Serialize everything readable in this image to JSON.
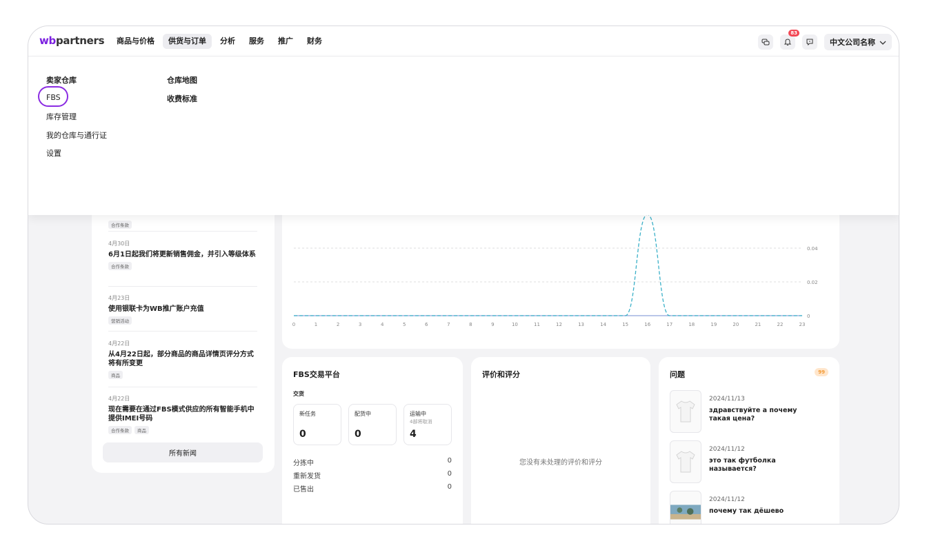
{
  "header": {
    "logo_prefix": "wb",
    "logo_suffix": "partners",
    "nav": [
      "商品与价格",
      "供货与订单",
      "分析",
      "服务",
      "推广",
      "财务"
    ],
    "notification_count": "83",
    "company_name": "中文公司名称"
  },
  "dropdown": {
    "col1": [
      "卖家仓库",
      "FBS",
      "库存管理",
      "我的仓库与通行证",
      "设置"
    ],
    "col2": [
      "仓库地图",
      "收费标准"
    ]
  },
  "news": {
    "partial_tag": "合作条款",
    "items": [
      {
        "date": "4月30日",
        "title": "6月1日起我们将更新销售佣金，并引入等级体系",
        "tags": [
          "合作条款"
        ]
      },
      {
        "date": "4月23日",
        "title": "使用银联卡为WB推广账户充值",
        "tags": [
          "营销活动"
        ]
      },
      {
        "date": "4月22日",
        "title": "从4月22日起，部分商品的商品详情页评分方式将有所变更",
        "tags": [
          "商品"
        ]
      },
      {
        "date": "4月22日",
        "title": "现在需要在通过FBS模式供应的所有智能手机中提供IMEI号码",
        "tags": [
          "合作条款",
          "商品"
        ]
      }
    ],
    "all_news": "所有新闻"
  },
  "chart_data": {
    "type": "line",
    "x": [
      0,
      1,
      2,
      3,
      4,
      5,
      6,
      7,
      8,
      9,
      10,
      11,
      12,
      13,
      14,
      15,
      16,
      17,
      18,
      19,
      20,
      21,
      22,
      23
    ],
    "series": [
      {
        "values": [
          0,
          0,
          0,
          0,
          0,
          0,
          0,
          0,
          0,
          0,
          0,
          0,
          0,
          0,
          0,
          0,
          0,
          0,
          0,
          0,
          0,
          0,
          0,
          0
        ],
        "color": "#8fa3d9"
      },
      {
        "values": [
          0,
          0,
          0,
          0,
          0,
          0,
          0,
          0,
          0,
          0,
          0,
          0,
          0,
          0,
          0,
          0,
          0.06,
          0,
          0,
          0,
          0,
          0,
          0,
          0
        ],
        "color": "#3ab0c8",
        "dashed": true
      }
    ],
    "y_ticks": [
      "0",
      "0.02",
      "0.04"
    ],
    "ylim": [
      0,
      0.06
    ],
    "grid": true
  },
  "fbs": {
    "title": "FBS交易平台",
    "section": "交货",
    "boxes": [
      {
        "label": "新任务",
        "note": "",
        "value": "0"
      },
      {
        "label": "配货中",
        "note": "",
        "value": "0"
      },
      {
        "label": "运输中",
        "note": "4部将取消",
        "value": "4"
      }
    ],
    "rows": [
      {
        "label": "分拣中",
        "value": "0"
      },
      {
        "label": "重新发货",
        "value": "0"
      },
      {
        "label": "已售出",
        "value": "0"
      }
    ]
  },
  "reviews": {
    "title": "评价和评分",
    "empty": "您没有未处理的评价和评分"
  },
  "questions": {
    "title": "问题",
    "badge": "99",
    "items": [
      {
        "date": "2024/11/13",
        "text": "здравствуйте а почему такая цена?",
        "thumb": "tshirt-icon"
      },
      {
        "date": "2024/11/12",
        "text": "это так футболка называется?",
        "thumb": "tshirt-icon"
      },
      {
        "date": "2024/11/12",
        "text": "почему так дёшево",
        "thumb": "photo-thumb"
      }
    ]
  },
  "colors": {
    "accent": "#7b1fe0",
    "highlight": "#8a2be2",
    "badge": "#f24855"
  }
}
